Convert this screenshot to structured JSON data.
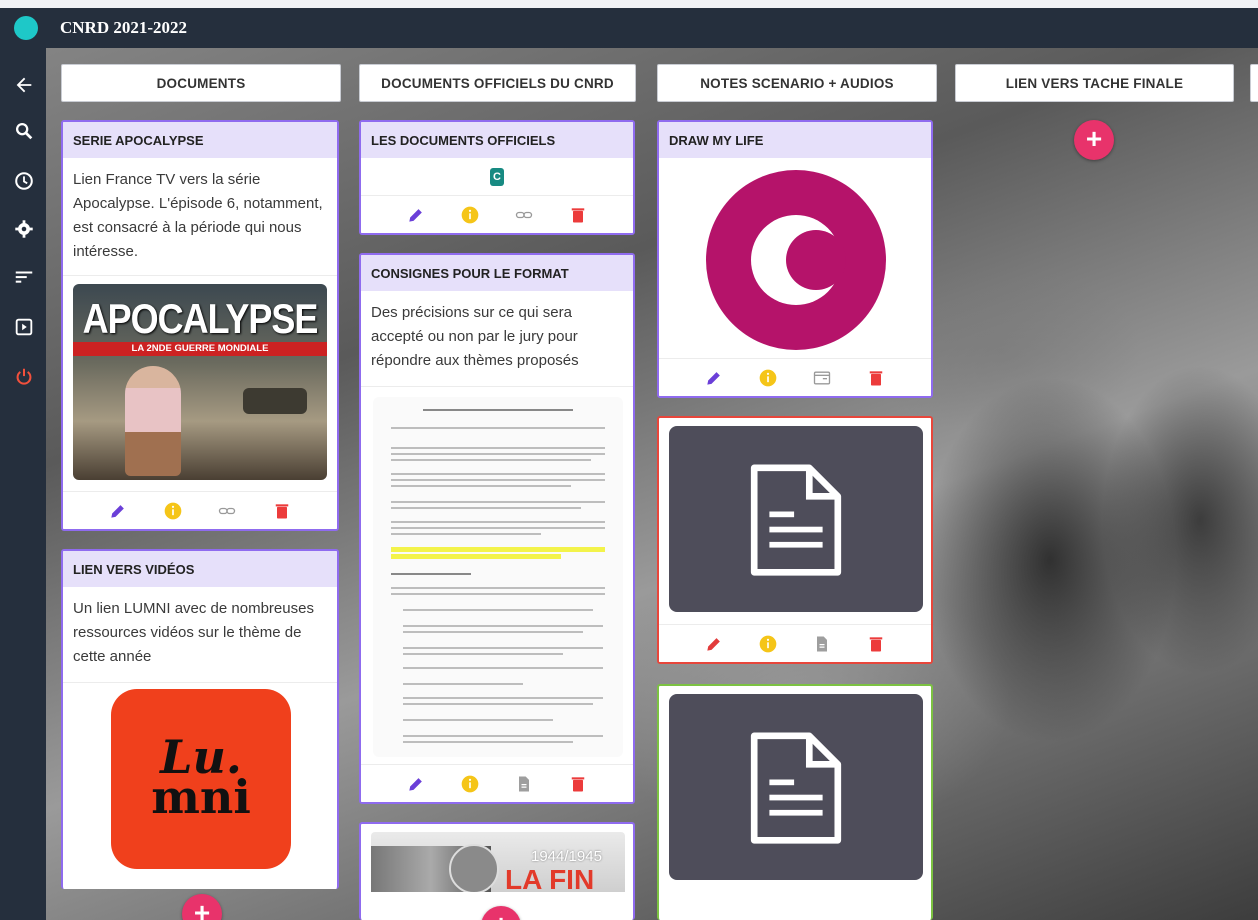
{
  "app": {
    "board_title": "CNRD 2021-2022"
  },
  "sidebar": {
    "icons": [
      "back-arrow-icon",
      "search-icon",
      "history-icon",
      "settings-icon",
      "sort-icon",
      "present-icon",
      "power-icon"
    ]
  },
  "columns": [
    {
      "title": "DOCUMENTS"
    },
    {
      "title": "DOCUMENTS OFFICIELS DU CNRD"
    },
    {
      "title": "NOTES SCENARIO + AUDIOS"
    },
    {
      "title": "LIEN VERS TACHE FINALE"
    }
  ],
  "cards": {
    "apocalypse": {
      "title": "SERIE APOCALYPSE",
      "text": "Lien France TV vers la série Apocalypse. L'épisode 6, notamment, est consacré à la période qui nous intéresse.",
      "image_title": "APOCALYPSE",
      "image_subtitle": "LA 2NDE GUERRE MONDIALE"
    },
    "videos": {
      "title": "LIEN VERS VIDÉOS",
      "text": "Un lien LUMNI avec de nombreuses ressources vidéos sur le thème de cette année",
      "logo_line1": "Lu.",
      "logo_line2": "mni"
    },
    "officiels": {
      "title": "LES DOCUMENTS OFFICIELS"
    },
    "consignes": {
      "title": "CONSIGNES POUR LE FORMAT",
      "text": "Des précisions sur ce qui sera accepté ou non par le jury pour répondre aux thèmes proposés"
    },
    "lafin": {
      "title_year": "1944/1945",
      "title_big": "LA FIN"
    },
    "drawmylife": {
      "title": "DRAW MY LIFE"
    }
  },
  "colors": {
    "accent": "#8f6bef",
    "card_header": "#e6e0fa",
    "add_button": "#e8336b",
    "red_border": "#e8463b",
    "green_border": "#7cc242",
    "topbar": "#252f3d",
    "cyan_logo": "#1ec8c8"
  }
}
